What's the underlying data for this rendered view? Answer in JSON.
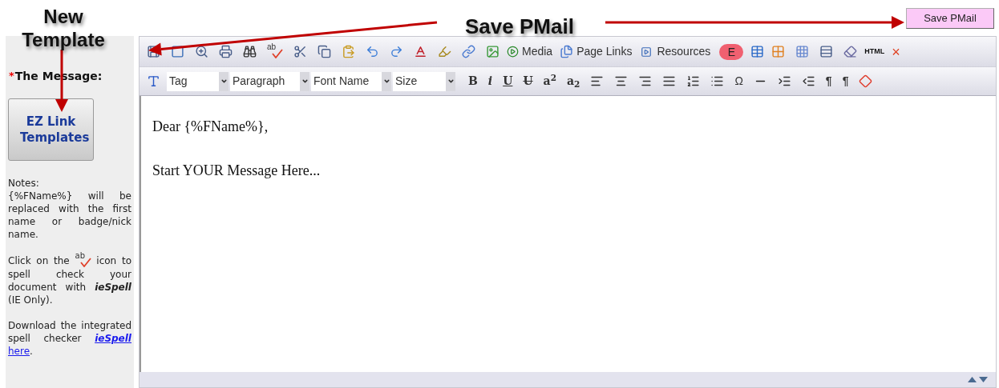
{
  "annotations": [
    {
      "kind": "side",
      "text": "New Template"
    },
    {
      "kind": "top",
      "text": "Save PMail"
    }
  ],
  "save_button": {
    "label": "Save PMail"
  },
  "sidebar": {
    "required_mark": "*",
    "label": "The Message:",
    "template_button": "EZ Link Templates",
    "notes": {
      "title": "Notes:",
      "text": "{%FName%} will be replaced with the first name or badge/nick name."
    },
    "spell_note": {
      "before": "Click on the",
      "icon_text": "ab",
      "after": "icon to spell check your document with",
      "emphasis": "ieSpell",
      "end": "(IE Only)."
    },
    "download_note": {
      "before": "Download the integrated spell checker",
      "link": "ieSpell",
      "link2": "here",
      "after": "."
    }
  },
  "toolbar_1": {
    "spell_icon_text": "ab",
    "media": "Media",
    "page_links": "Page Links",
    "resources": "Resources",
    "e_badge": "E",
    "html": "HTML",
    "close": "×"
  },
  "toolbar_2": {
    "dropdowns": [
      {
        "value": "Tag"
      },
      {
        "value": "Paragraph"
      },
      {
        "value": "Font Name"
      },
      {
        "value": "Size"
      }
    ],
    "format_buttons": [
      {
        "kind": "bold",
        "label": "B"
      },
      {
        "kind": "italic",
        "label": "i"
      },
      {
        "kind": "underline",
        "label": "U"
      },
      {
        "kind": "strike",
        "label": "U"
      },
      {
        "kind": "sup",
        "label": "a$^{2}$"
      },
      {
        "kind": "sub",
        "label": "a$_{2}$"
      }
    ],
    "symbol": "Ω",
    "ltr": "¶",
    "rtl": "¶"
  },
  "editor": {
    "lines": [
      "Dear {%FName%},",
      "Start YOUR Message Here..."
    ]
  }
}
